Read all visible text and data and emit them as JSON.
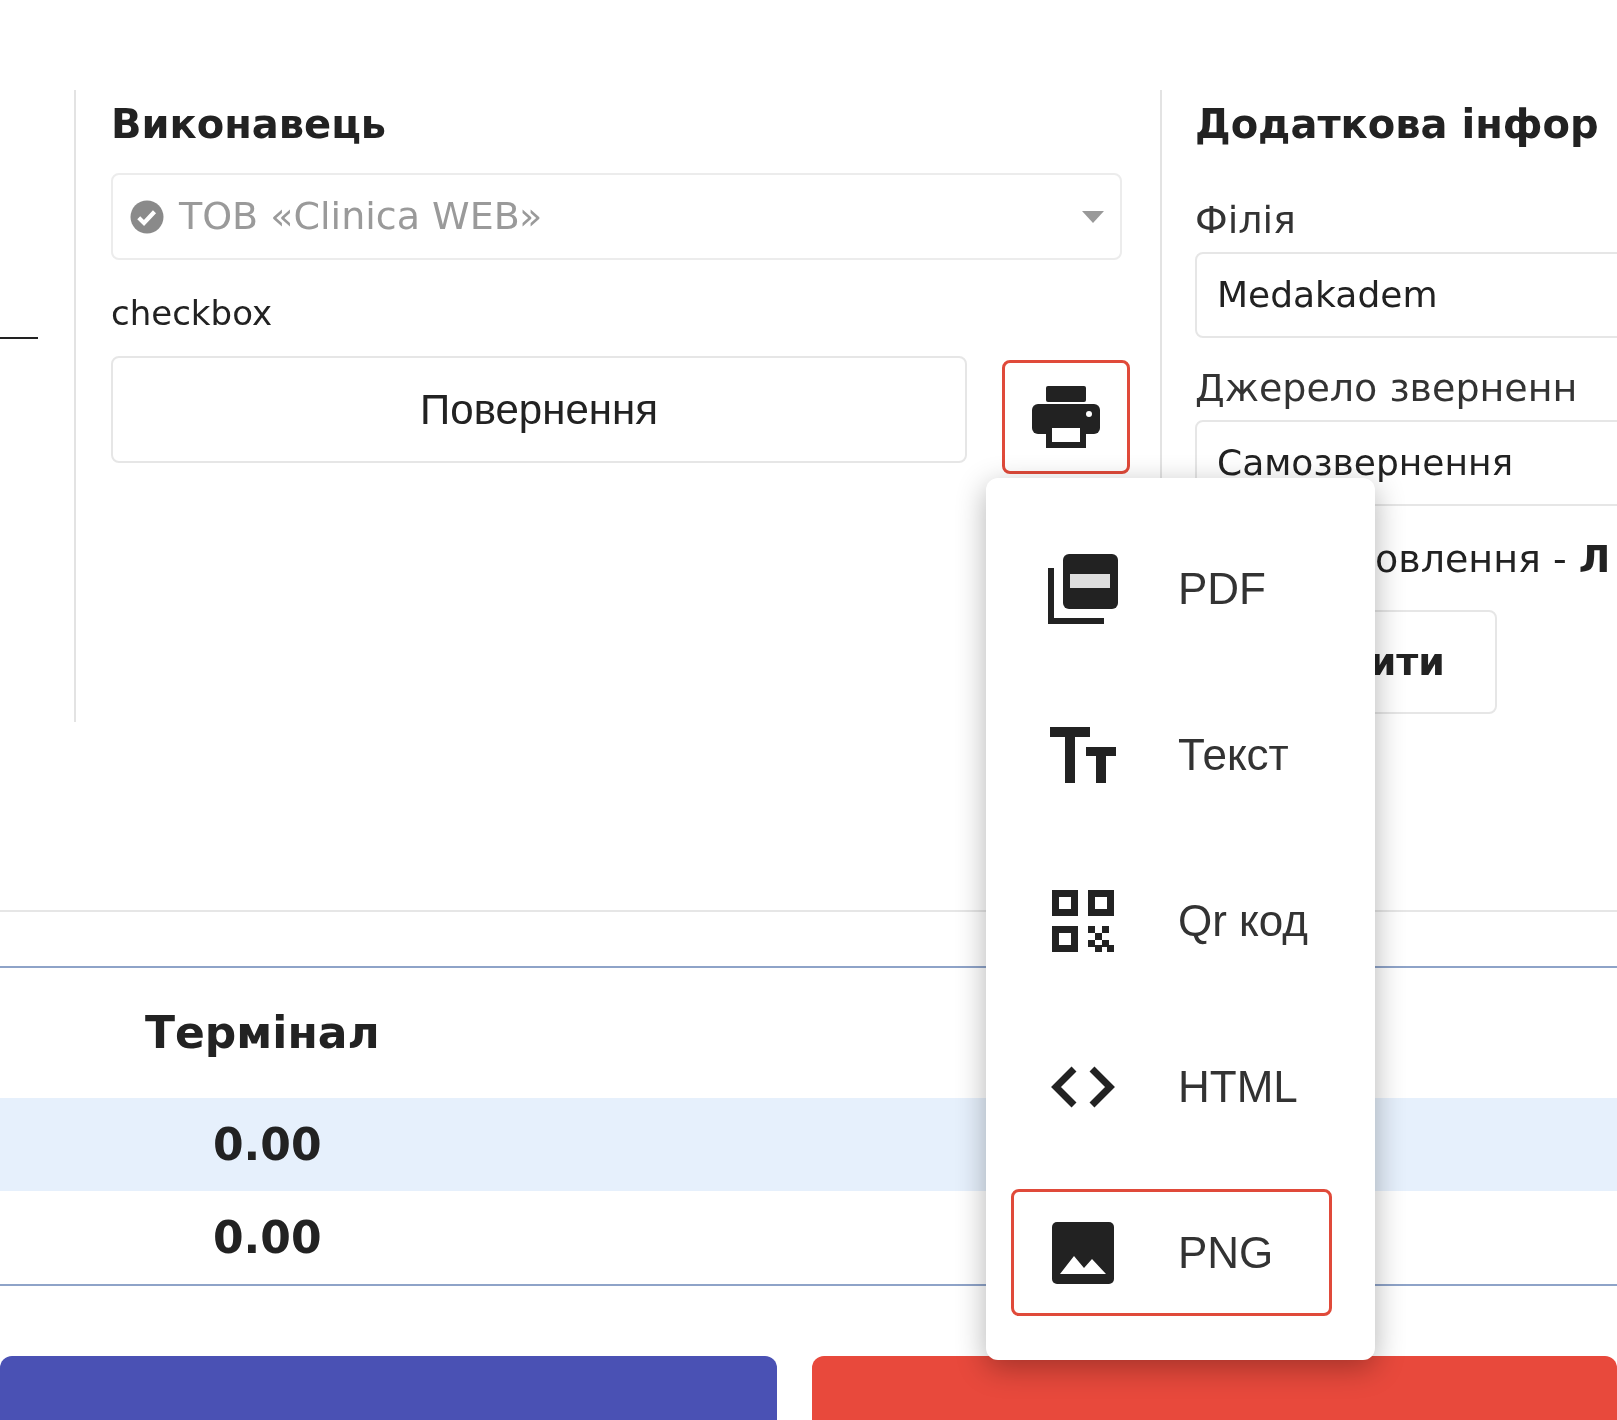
{
  "performer": {
    "heading": "Виконавець",
    "select": {
      "value": "ТОВ «Clinica WEB»",
      "disabled": true
    },
    "checkbox_label": "checkbox",
    "return_button": "Повернення",
    "print_button": {
      "active": true
    }
  },
  "additional_info": {
    "heading": "Додаткова інфор",
    "fields": [
      {
        "label": "Філія",
        "value": "Medakadem"
      },
      {
        "label": "Джерело зверненн",
        "value": "Самозвернення"
      }
    ],
    "note": "овлення - **Л**",
    "button": "ити"
  },
  "payments": {
    "column": "Термінал",
    "rows": [
      {
        "value": "0.00",
        "highlighted": true
      },
      {
        "value": "0.00",
        "highlighted": false
      }
    ]
  },
  "print_menu": {
    "items": [
      {
        "kind": "pdf",
        "label": "PDF",
        "selected": false
      },
      {
        "kind": "text",
        "label": "Текст",
        "selected": false
      },
      {
        "kind": "qr",
        "label": "Qr код",
        "selected": false
      },
      {
        "kind": "html",
        "label": "HTML",
        "selected": false
      },
      {
        "kind": "png",
        "label": "PNG",
        "selected": true
      }
    ]
  },
  "footer_buttons": [
    {
      "kind": "primary"
    },
    {
      "kind": "danger"
    }
  ]
}
